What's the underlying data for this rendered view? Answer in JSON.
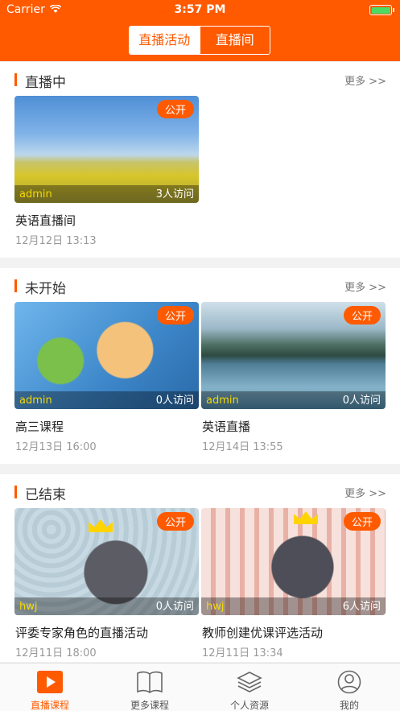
{
  "status_bar": {
    "carrier": "Carrier",
    "time": "3:57 PM"
  },
  "nav": {
    "segments": [
      "直播活动",
      "直播间"
    ],
    "active_index": 0
  },
  "sections": [
    {
      "title": "直播中",
      "more": "更多 >>",
      "cards": [
        {
          "badge": "公开",
          "author": "admin",
          "visits": "3人访问",
          "title": "英语直播间",
          "date": "12月12日 13:13"
        }
      ]
    },
    {
      "title": "未开始",
      "more": "更多 >>",
      "cards": [
        {
          "badge": "公开",
          "author": "admin",
          "visits": "0人访问",
          "title": "高三课程",
          "date": "12月13日 16:00"
        },
        {
          "badge": "公开",
          "author": "admin",
          "visits": "0人访问",
          "title": "英语直播",
          "date": "12月14日 13:55"
        }
      ]
    },
    {
      "title": "已结束",
      "more": "更多 >>",
      "cards": [
        {
          "badge": "公开",
          "author": "hwj",
          "visits": "0人访问",
          "title": "评委专家角色的直播活动",
          "date": "12月11日 18:00"
        },
        {
          "badge": "公开",
          "author": "hwj",
          "visits": "6人访问",
          "title": "教师创建优课评选活动",
          "date": "12月11日 13:34"
        }
      ]
    }
  ],
  "tabs": [
    {
      "label": "直播课程",
      "icon": "play-icon",
      "active": true
    },
    {
      "label": "更多课程",
      "icon": "book-icon",
      "active": false
    },
    {
      "label": "个人资源",
      "icon": "layers-icon",
      "active": false
    },
    {
      "label": "我的",
      "icon": "user-icon",
      "active": false
    }
  ],
  "colors": {
    "accent": "#ff5a00",
    "author_text": "#f5d800",
    "battery": "#4cd964"
  }
}
